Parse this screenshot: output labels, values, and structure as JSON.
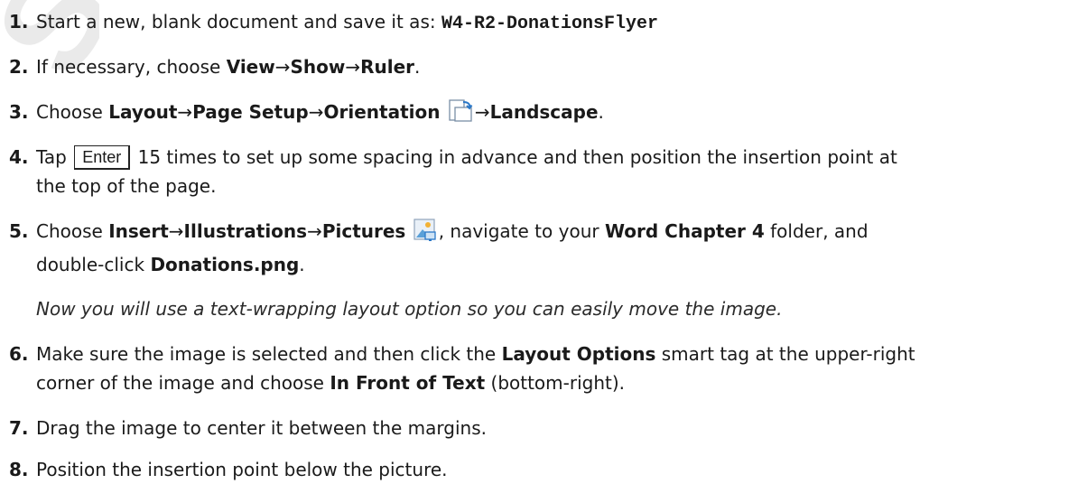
{
  "watermark": "SAMPLE",
  "steps": [
    {
      "num": "1.",
      "pre": "Start a new, blank document and save it as:",
      "file": "W4-R2-DonationsFlyer"
    },
    {
      "num": "2.",
      "pre": "If necessary, choose",
      "path": [
        "View",
        "Show",
        "Ruler"
      ],
      "post": "."
    },
    {
      "num": "3.",
      "pre": "Choose",
      "path": [
        "Layout",
        "Page Setup",
        "Orientation"
      ],
      "icon": "orientation-icon",
      "last": "Landscape",
      "post": "."
    },
    {
      "num": "4.",
      "pre": "Tap",
      "key": "Enter",
      "line1": "15 times to set up some spacing in advance and then position the insertion point at",
      "line2": "the top of the page."
    },
    {
      "num": "5.",
      "pre": "Choose",
      "path": [
        "Insert",
        "Illustrations",
        "Pictures"
      ],
      "icon": "pictures-icon",
      "mid": ", navigate to your",
      "folder": "Word Chapter 4",
      "mid2": "folder, and",
      "line2_pre": "double-click",
      "filename": "Donations.png",
      "post": "."
    },
    {
      "num": "6.",
      "pre": "Make sure the image is selected and then click the",
      "b1": "Layout Options",
      "mid": "smart tag at the upper-right",
      "line2_pre": "corner of the image and choose",
      "b2": "In Front of Text",
      "post": "(bottom-right)."
    },
    {
      "num": "7.",
      "text": "Drag the image to center it between the margins."
    },
    {
      "num": "8.",
      "text": "Position the insertion point below the picture."
    }
  ],
  "note": "Now you will use a text-wrapping layout option so you can easily move the image.",
  "arrow": "→"
}
